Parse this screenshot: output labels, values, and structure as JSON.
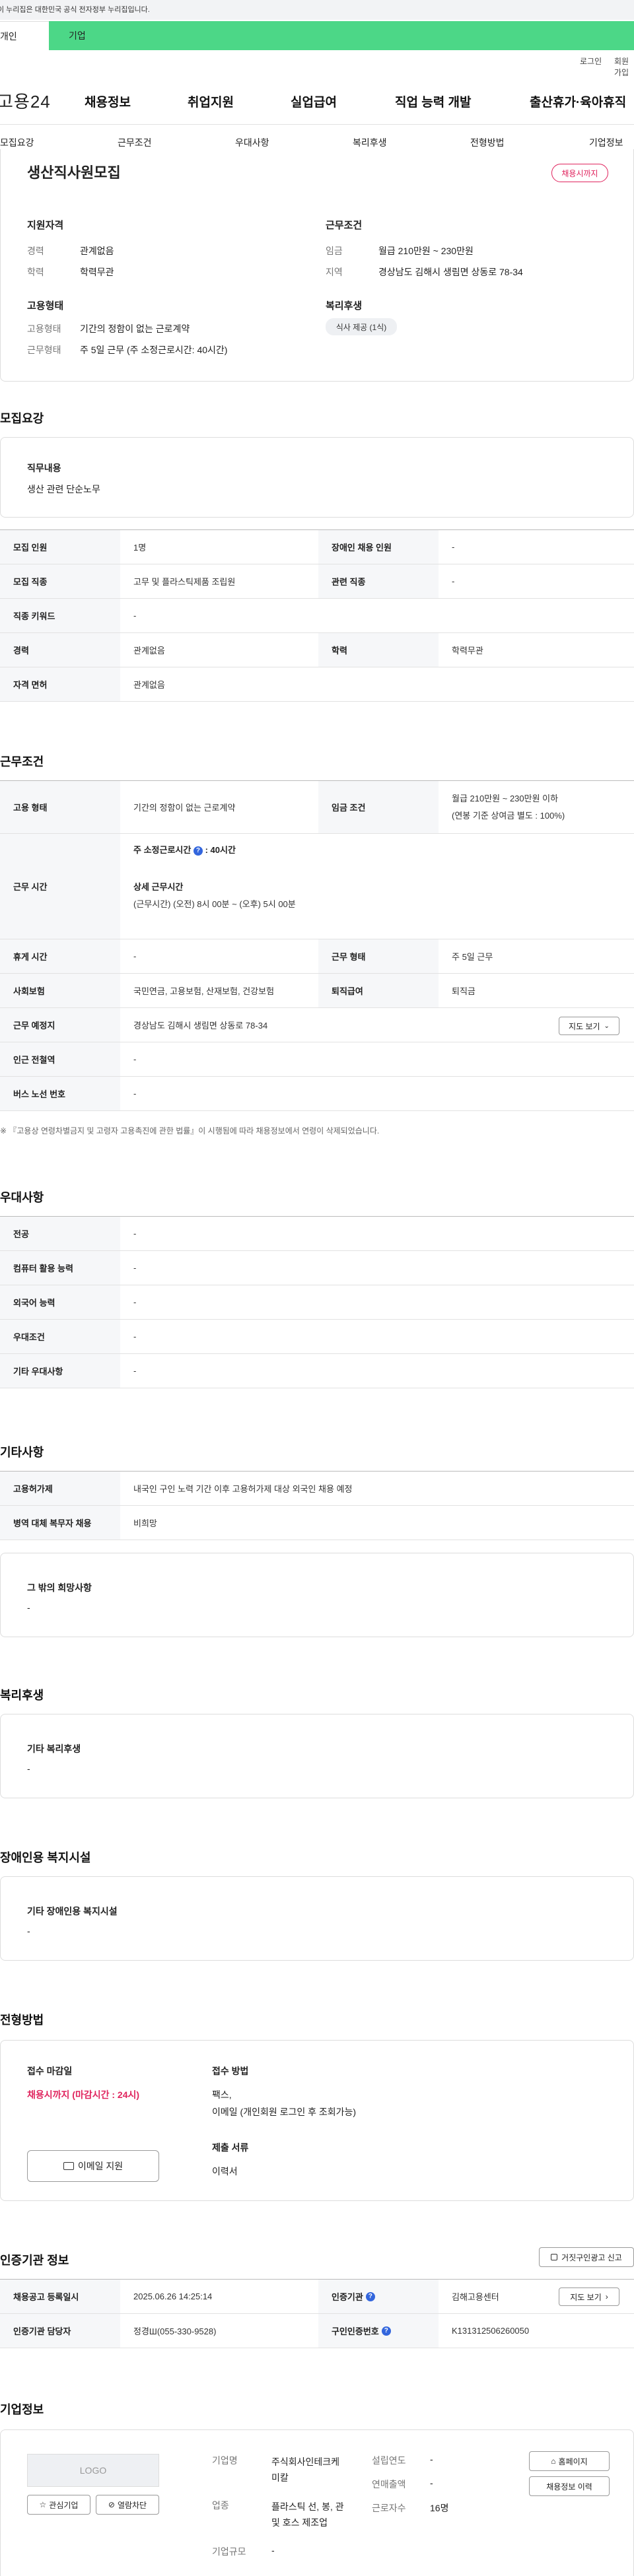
{
  "gov_banner": "이 누리집은 대한민국 공식 전자정부 누리집입니다.",
  "user_tabs": [
    "개인",
    "기업"
  ],
  "util": [
    "로그인",
    "회원가입"
  ],
  "logo": "고용24",
  "gnb": [
    "채용정보",
    "취업지원",
    "실업급여",
    "직업 능력 개발",
    "출산휴가·육아휴직"
  ],
  "subnav": [
    "모집요강",
    "근무조건",
    "우대사항",
    "복리후생",
    "전형방법",
    "기업정보"
  ],
  "summary": {
    "title": "생산직사원모집",
    "badge": "채용시까지",
    "qual_title": "지원자격",
    "career_lbl": "경력",
    "career_val": "관계없음",
    "edu_lbl": "학력",
    "edu_val": "학력무관",
    "emp_title": "고용형태",
    "emptype_lbl": "고용형태",
    "emptype_val": "기간의 정함이 없는 근로계약",
    "worktype_lbl": "근무형태",
    "worktype_val": "주 5일 근무 (주 소정근로시간: 40시간)",
    "cond_title": "근무조건",
    "wage_lbl": "임금",
    "wage_val": "월급 210만원 ~ 230만원",
    "area_lbl": "지역",
    "area_val": "경상남도 김해시 생림면 상동로 78-34",
    "welfare_title": "복리후생",
    "welfare_tag": "식사 제공 (1식)"
  },
  "recruit": {
    "title": "모집요강",
    "duty_title": "직무내용",
    "duty_val": "생산 관련 단순노무",
    "rows": [
      {
        "th": "모집 인원",
        "td": "1명",
        "th2": "장애인 채용 인원",
        "td2": "-"
      },
      {
        "th": "모집 직종",
        "td": "고무 및 플라스틱제품 조립원",
        "th2": "관련 직종",
        "td2": "-"
      },
      {
        "th": "직종 키워드",
        "td": "-"
      },
      {
        "th": "경력",
        "td": "관계없음",
        "th2": "학력",
        "td2": "학력무관"
      },
      {
        "th": "자격 면허",
        "td": "관계없음"
      }
    ]
  },
  "cond": {
    "title": "근무조건",
    "emp_th": "고용 형태",
    "emp_td": "기간의 정함이 없는 근로계약",
    "wage_th": "임금 조건",
    "wage_td1": "월급 210만원 ~ 230만원 이하",
    "wage_td2": "(연봉 기준 상여금 별도 : 100%)",
    "time_th": "근무 시간",
    "time_a": "주 소정근로시간",
    "time_b": ": 40시간",
    "time_detail_title": "상세 근무시간",
    "time_detail": "(근무시간) (오전) 8시 00분 ~ (오후) 5시 00분",
    "rows": [
      {
        "th": "휴게 시간",
        "td": "-",
        "th2": "근무 형태",
        "td2": "주 5일 근무"
      },
      {
        "th": "사회보험",
        "td": "국민연금, 고용보험, 산재보험, 건강보험",
        "th2": "퇴직급여",
        "td2": "퇴직금"
      },
      {
        "th": "근무 예정지",
        "td": "경상남도 김해시 생림면 상동로 78-34"
      },
      {
        "th": "인근 전철역",
        "td": "-"
      },
      {
        "th": "버스 노선 번호",
        "td": "-"
      }
    ],
    "map_btn": "지도 보기",
    "note": "※ 『고용상 연령차별금지 및 고령자 고용촉진에 관한 법률』이 시행됨에 따라 채용정보에서 연령이 삭제되었습니다."
  },
  "pref": {
    "title": "우대사항",
    "rows": [
      {
        "th": "전공",
        "td": "-"
      },
      {
        "th": "컴퓨터 활용 능력",
        "td": "-"
      },
      {
        "th": "외국어 능력",
        "td": "-"
      },
      {
        "th": "우대조건",
        "td": "-"
      },
      {
        "th": "기타 우대사항",
        "td": "-"
      }
    ]
  },
  "etc": {
    "title": "기타사항",
    "rows": [
      {
        "th": "고용허가제",
        "td": "내국인 구인 노력 기간 이후 고용허가제 대상 외국인 채용 예정"
      },
      {
        "th": "병역 대체 복무자 채용",
        "td": "비희망"
      }
    ],
    "other_title": "그 밖의 희망사항",
    "other_val": "-"
  },
  "welfare": {
    "title": "복리후생",
    "sub": "기타 복리후생",
    "val": "-"
  },
  "disabled": {
    "title": "장애인용 복지시설",
    "sub": "기타 장애인용 복지시설",
    "val": "-"
  },
  "process": {
    "title": "전형방법",
    "deadline_title": "접수 마감일",
    "deadline_val": "채용시까지 (마감시간 : 24시)",
    "apply_btn": "이메일 지원",
    "method_title": "접수 방법",
    "method_val1": "팩스,",
    "method_val2": "이메일 (개인회원 로그인 후 조회가능)",
    "docs_title": "제출 서류",
    "docs_val": "이력서"
  },
  "agency": {
    "title": "인증기관 정보",
    "report_btn": "거짓구인광고 신고",
    "rows": [
      {
        "th": "채용공고 등록일시",
        "td": "2025.06.26 14:25:14",
        "th2": "인증기관",
        "td2": "김해고용센터"
      },
      {
        "th": "인증기관 담당자",
        "td": "정경Ш(055-330-9528)",
        "th2": "구인인증번호",
        "td2": "K131312506260050"
      }
    ],
    "map_btn": "지도 보기"
  },
  "company": {
    "title": "기업정보",
    "logo_text": "LOGO",
    "fav_btn": "관심기업",
    "block_btn": "열람차단",
    "name_lbl": "기업명",
    "name_val": "주식회사인테크케미칼",
    "biz_lbl": "업종",
    "biz_val": "플라스틱 선, 봉, 관 및 호스 제조업",
    "size_lbl": "기업규모",
    "size_val": "-",
    "year_lbl": "설립연도",
    "year_val": "-",
    "sales_lbl": "연매출액",
    "sales_val": "-",
    "emp_lbl": "근로자수",
    "emp_val": "16명",
    "home_btn": "홈페이지",
    "history_btn": "채용정보 이력"
  }
}
